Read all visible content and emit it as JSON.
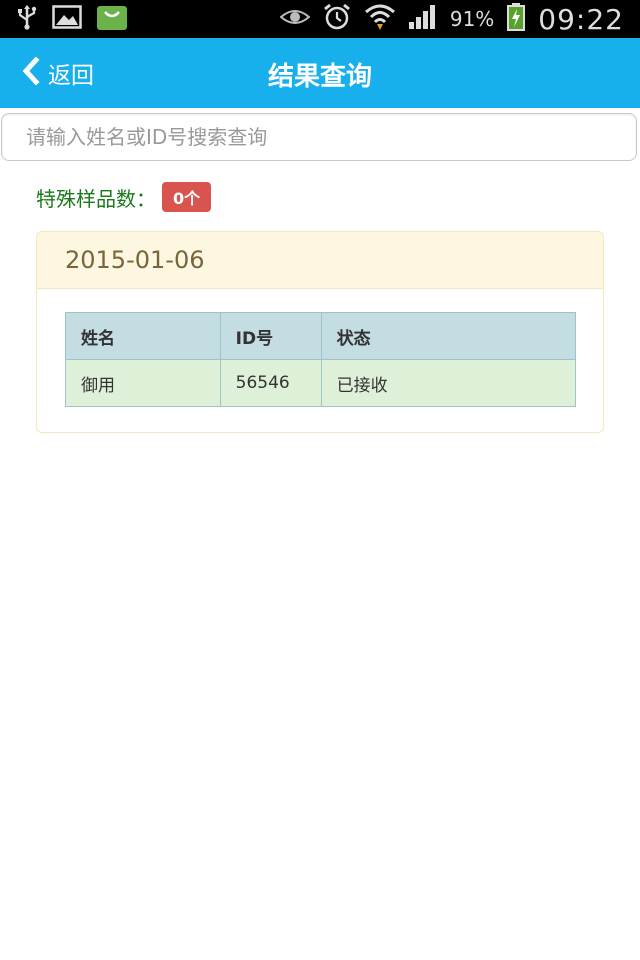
{
  "status_bar": {
    "battery_percent": "91%",
    "time": "09:22",
    "icons": [
      "usb-icon",
      "image-icon",
      "shopping-bag-icon",
      "eye-icon",
      "alarm-icon",
      "wifi-icon",
      "signal-icon",
      "battery-charging-icon"
    ]
  },
  "header": {
    "back_label": "返回",
    "title": "结果查询"
  },
  "search": {
    "placeholder": "请输入姓名或ID号搜索查询",
    "value": ""
  },
  "special": {
    "label": "特殊样品数：",
    "count": "0个"
  },
  "results": [
    {
      "date": "2015-01-06",
      "columns": [
        "姓名",
        "ID号",
        "状态"
      ],
      "rows": [
        [
          "御用",
          "56546",
          "已接收"
        ]
      ]
    }
  ],
  "colors": {
    "header_bg": "#18b0ec",
    "special_label": "#1a7a1a",
    "badge_bg": "#d9534f",
    "card_head_bg": "#fdf7e2",
    "table_head_bg": "#c4dde2",
    "table_row_bg": "#dff0d8"
  }
}
